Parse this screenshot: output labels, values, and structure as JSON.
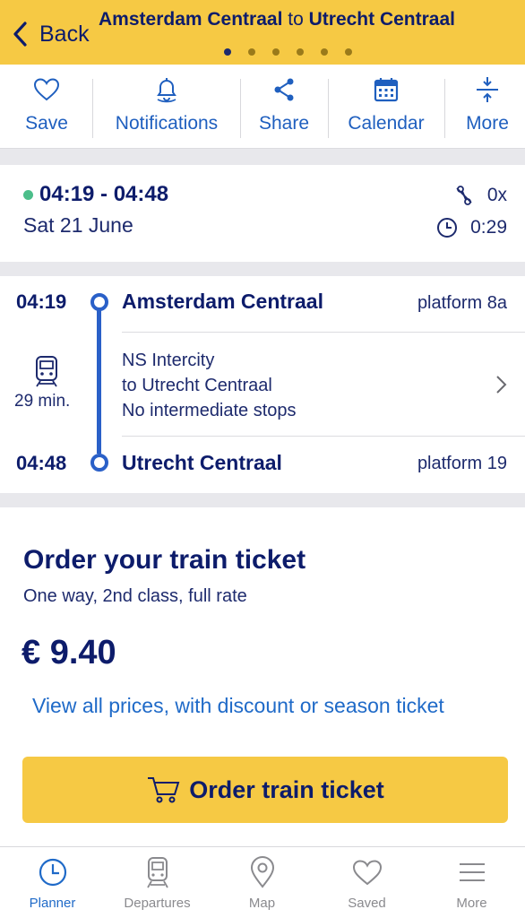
{
  "header": {
    "back_label": "Back",
    "origin": "Amsterdam Centraal",
    "connector": "to",
    "destination": "Utrecht Centraal",
    "page_count": 6,
    "active_page": 1
  },
  "toolbar": {
    "items": [
      {
        "label": "Save",
        "icon": "heart-icon"
      },
      {
        "label": "Notifications",
        "icon": "bell-icon"
      },
      {
        "label": "Share",
        "icon": "share-icon"
      },
      {
        "label": "Calendar",
        "icon": "calendar-icon"
      },
      {
        "label": "More",
        "icon": "expand-icon"
      }
    ]
  },
  "summary": {
    "time_range": "04:19 - 04:48",
    "date": "Sat 21 June",
    "transfers": "0x",
    "duration": "0:29",
    "status_color": "#4cbe8a"
  },
  "journey": {
    "departure": {
      "time": "04:19",
      "station": "Amsterdam Centraal",
      "platform": "platform 8a"
    },
    "leg": {
      "duration": "29 min.",
      "operator": "NS Intercity",
      "direction": "to Utrecht Centraal",
      "stops": "No intermediate stops"
    },
    "arrival": {
      "time": "04:48",
      "station": "Utrecht Centraal",
      "platform": "platform 19"
    }
  },
  "ticket": {
    "title": "Order your train ticket",
    "subtitle": "One way, 2nd class, full rate",
    "price": "€ 9.40",
    "link": "View all prices, with discount or season ticket",
    "button": "Order train ticket"
  },
  "bottom_nav": {
    "items": [
      {
        "label": "Planner",
        "icon": "clock-icon",
        "active": true
      },
      {
        "label": "Departures",
        "icon": "train-icon",
        "active": false
      },
      {
        "label": "Map",
        "icon": "map-pin-icon",
        "active": false
      },
      {
        "label": "Saved",
        "icon": "heart-icon",
        "active": false
      },
      {
        "label": "More",
        "icon": "menu-icon",
        "active": false
      }
    ]
  },
  "colors": {
    "brand_yellow": "#f6c944",
    "navy": "#0d1c6b",
    "link_blue": "#1f6ac8",
    "route_blue": "#2a60c8"
  }
}
